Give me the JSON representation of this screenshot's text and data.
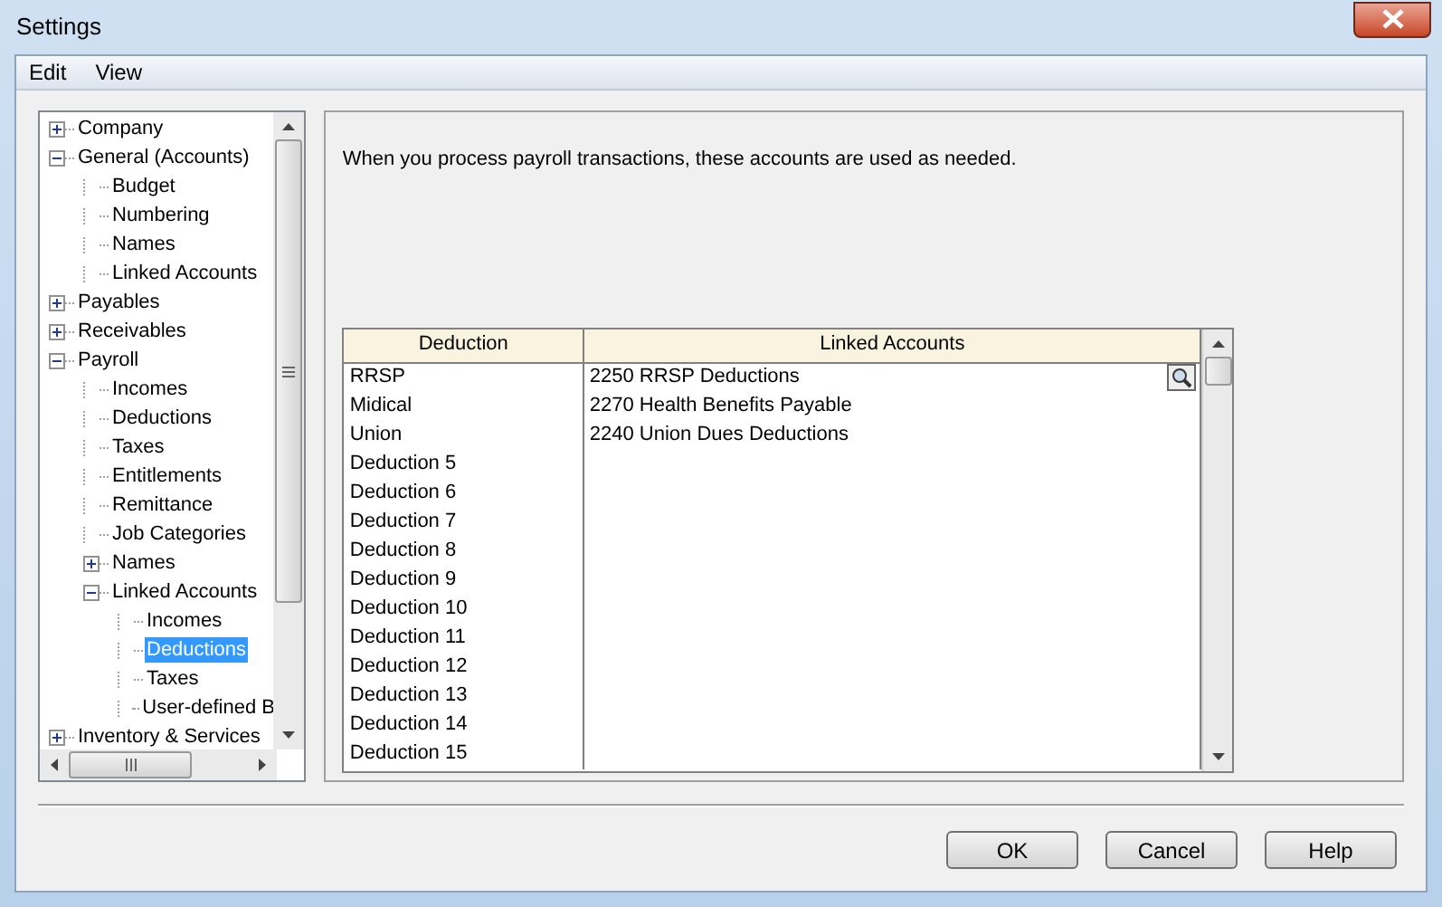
{
  "window": {
    "title": "Settings"
  },
  "menu": [
    "Edit",
    "View"
  ],
  "tree": [
    {
      "label": "Company",
      "expanded": false,
      "selected": false
    },
    {
      "label": "General (Accounts)",
      "expanded": true,
      "selected": false,
      "children": [
        {
          "label": "Budget",
          "selected": false
        },
        {
          "label": "Numbering",
          "selected": false
        },
        {
          "label": "Names",
          "selected": false
        },
        {
          "label": "Linked Accounts",
          "selected": false
        }
      ]
    },
    {
      "label": "Payables",
      "expanded": false,
      "selected": false
    },
    {
      "label": "Receivables",
      "expanded": false,
      "selected": false
    },
    {
      "label": "Payroll",
      "expanded": true,
      "selected": false,
      "children": [
        {
          "label": "Incomes",
          "selected": false
        },
        {
          "label": "Deductions",
          "selected": false
        },
        {
          "label": "Taxes",
          "selected": false
        },
        {
          "label": "Entitlements",
          "selected": false
        },
        {
          "label": "Remittance",
          "selected": false
        },
        {
          "label": "Job Categories",
          "selected": false
        },
        {
          "label": "Names",
          "expanded": false,
          "selected": false
        },
        {
          "label": "Linked Accounts",
          "expanded": true,
          "selected": false,
          "children": [
            {
              "label": "Incomes",
              "selected": false
            },
            {
              "label": "Deductions",
              "selected": true
            },
            {
              "label": "Taxes",
              "selected": false
            },
            {
              "label": "User-defined B",
              "selected": false
            }
          ]
        }
      ]
    },
    {
      "label": "Inventory & Services",
      "expanded": false,
      "selected": false
    }
  ],
  "description": "When you process payroll transactions, these accounts are used as needed.",
  "table": {
    "columns": [
      "Deduction",
      "Linked Accounts"
    ],
    "rows": [
      [
        "RRSP",
        "2250 RRSP Deductions"
      ],
      [
        "Midical",
        "2270 Health Benefits Payable"
      ],
      [
        "Union",
        "2240 Union Dues Deductions"
      ],
      [
        "Deduction 5",
        ""
      ],
      [
        "Deduction 6",
        ""
      ],
      [
        "Deduction 7",
        ""
      ],
      [
        "Deduction 8",
        ""
      ],
      [
        "Deduction 9",
        ""
      ],
      [
        "Deduction 10",
        ""
      ],
      [
        "Deduction 11",
        ""
      ],
      [
        "Deduction 12",
        ""
      ],
      [
        "Deduction 13",
        ""
      ],
      [
        "Deduction 14",
        ""
      ],
      [
        "Deduction 15",
        ""
      ]
    ]
  },
  "buttons": [
    "OK",
    "Cancel",
    "Help"
  ]
}
